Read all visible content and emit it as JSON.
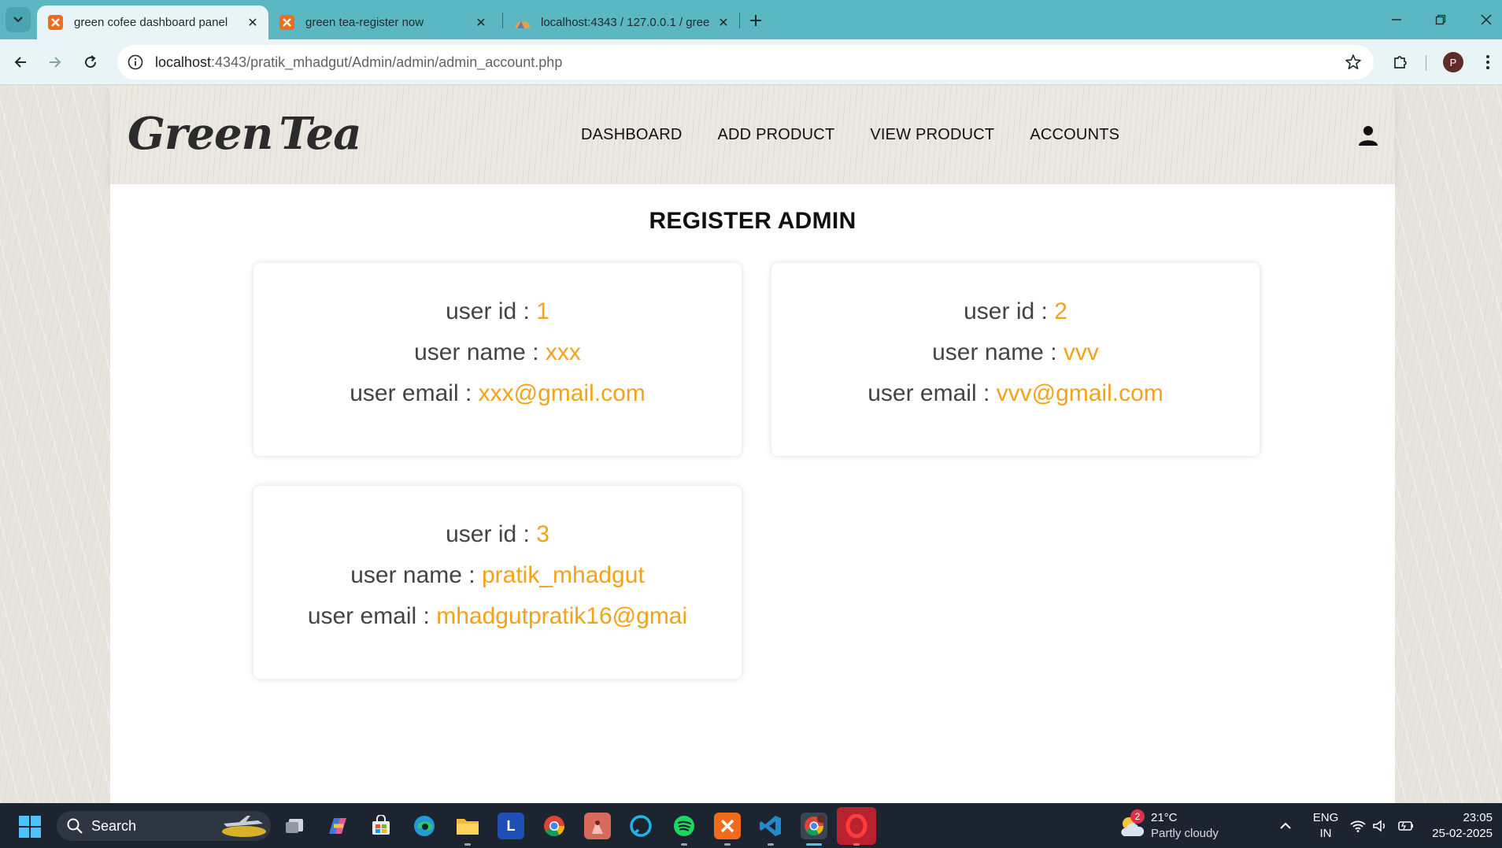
{
  "browser": {
    "tabs": [
      {
        "title": "green cofee dashboard panel",
        "active": true
      },
      {
        "title": "green tea-register now",
        "active": false
      },
      {
        "title": "localhost:4343 / 127.0.0.1 / gree",
        "active": false
      }
    ],
    "url_host": "localhost",
    "url_rest": ":4343/pratik_mhadgut/Admin/admin/admin_account.php",
    "profile_initial": "P"
  },
  "site": {
    "logo_word1": "Green",
    "logo_word2": "Tea",
    "nav": [
      "DASHBOARD",
      "ADD PRODUCT",
      "VIEW PRODUCT",
      "ACCOUNTS"
    ]
  },
  "page": {
    "title": "REGISTER ADMIN",
    "labels": {
      "id": "user id : ",
      "name": "user name : ",
      "email": "user email : "
    },
    "accounts": [
      {
        "id": "1",
        "name": "xxx",
        "email": "xxx@gmail.com"
      },
      {
        "id": "2",
        "name": "vvv",
        "email": "vvv@gmail.com"
      },
      {
        "id": "3",
        "name": "pratik_mhadgut",
        "email": "mhadgutpratik16@gmai"
      }
    ]
  },
  "taskbar": {
    "search_label": "Search",
    "weather_badge": "2",
    "temperature": "21°C",
    "condition": "Partly cloudy",
    "lang_line1": "ENG",
    "lang_line2": "IN",
    "time": "23:05",
    "date": "25-02-2025"
  },
  "colors": {
    "accent_value": "#f5a21b",
    "tabstrip": "#5bb8c3",
    "taskbar": "#1c2430"
  }
}
